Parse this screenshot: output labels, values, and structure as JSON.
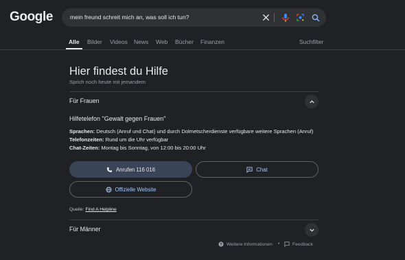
{
  "header": {
    "logo": "Google",
    "search_query": "mein freund schreit mich an, was soll ich tun?"
  },
  "tabs": [
    "Alle",
    "Bilder",
    "Videos",
    "News",
    "Web",
    "Bücher",
    "Finanzen"
  ],
  "filter_label": "Suchfilter",
  "panel": {
    "title": "Hier findest du Hilfe",
    "subtitle": "Sprich noch heute mit jemandem",
    "section1": {
      "label": "Für Frauen",
      "hotline_title": "Hilfetelefon \"Gewalt gegen Frauen\"",
      "lines": [
        {
          "key": "Sprachen:",
          "value": " Deutsch (Anruf und Chat) und durch Dolmetscherdienste verfügbare weitere Sprachen (Anruf)"
        },
        {
          "key": "Telefonzeiten:",
          "value": " Rund um die Uhr verfügbar"
        },
        {
          "key": "Chat-Zeiten:",
          "value": " Montag bis Sonntag, von 12:00 bis 20:00 Uhr"
        }
      ],
      "call_label": "Anrufen 116 016",
      "chat_label": "Chat",
      "website_label": "Offizielle Website"
    },
    "source_label": "Quelle:",
    "source_link": "Find A Helpline",
    "section2": {
      "label": "Für Männer"
    }
  },
  "footer": {
    "more_info": "Weitere Informationen",
    "separator": "•",
    "feedback": "Feedback"
  },
  "colors": {
    "background": "#202124",
    "search_bg": "#303134",
    "primary_pill": "#394457",
    "link_blue": "#a8c7fa"
  }
}
